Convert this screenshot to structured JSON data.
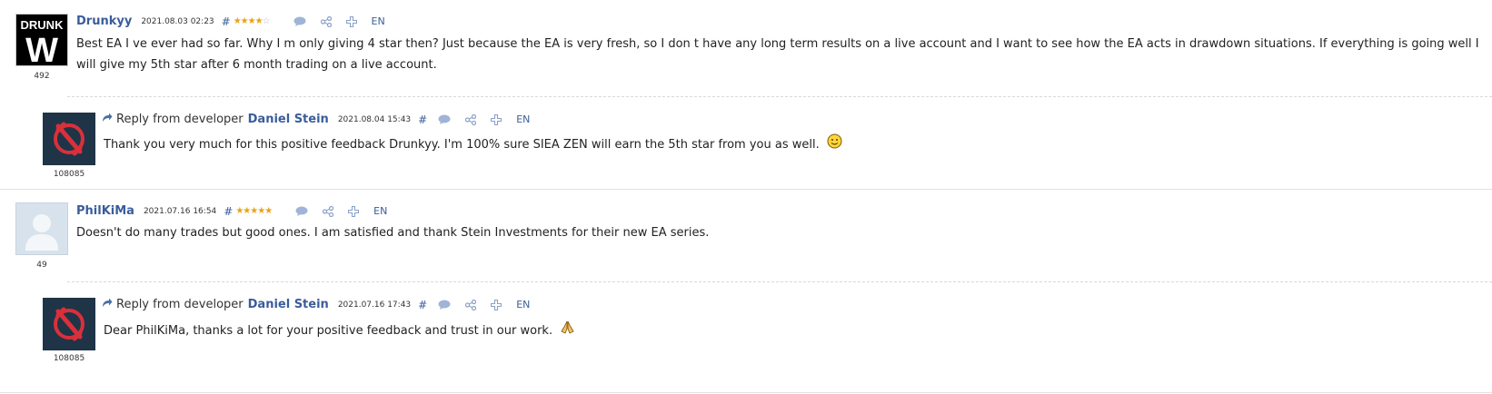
{
  "reviews": [
    {
      "author": "Drunkyy",
      "date": "2021.08.03 02:23",
      "hash": "#",
      "stars_filled": 4,
      "stars_total": 5,
      "lang": "EN",
      "rating": "492",
      "avatar_text_top": "DRUNK",
      "avatar_text_bottom": "W",
      "text": "Best EA I ve ever had so far. Why I m only giving 4 star then? Just because the EA is very fresh, so I don t have any long term results on a live account and I want to see how the EA acts in drawdown situations. If everything is going well I will give my 5th star after 6 month trading on a live account.",
      "reply": {
        "prefix": "Reply from developer",
        "developer": "Daniel Stein",
        "date": "2021.08.04 15:43",
        "hash": "#",
        "lang": "EN",
        "rating": "108085",
        "text": "Thank you very much for this positive feedback Drunkyy. I'm 100% sure SIEA ZEN will earn the 5th star from you as well."
      }
    },
    {
      "author": "PhilKiMa",
      "date": "2021.07.16 16:54",
      "hash": "#",
      "stars_filled": 5,
      "stars_total": 5,
      "lang": "EN",
      "rating": "49",
      "text": "Doesn't do many trades but good ones. I am satisfied and thank Stein Investments for their new EA series.",
      "reply": {
        "prefix": "Reply from developer",
        "developer": "Daniel Stein",
        "date": "2021.07.16 17:43",
        "hash": "#",
        "lang": "EN",
        "rating": "108085",
        "text": "Dear PhilKiMa, thanks a lot for your positive feedback and trust in our work."
      }
    }
  ],
  "icons": {
    "comment": "comment-icon",
    "share": "share-icon",
    "add": "plus-icon",
    "reply": "reply-arrow-icon",
    "smile": "smiley-emoji",
    "pray": "praying-hands-emoji"
  },
  "colors": {
    "link": "#3a5d9a",
    "star": "#e8a317",
    "developer_avatar_bg": "#1f3447",
    "developer_logo": "#d9303a"
  }
}
